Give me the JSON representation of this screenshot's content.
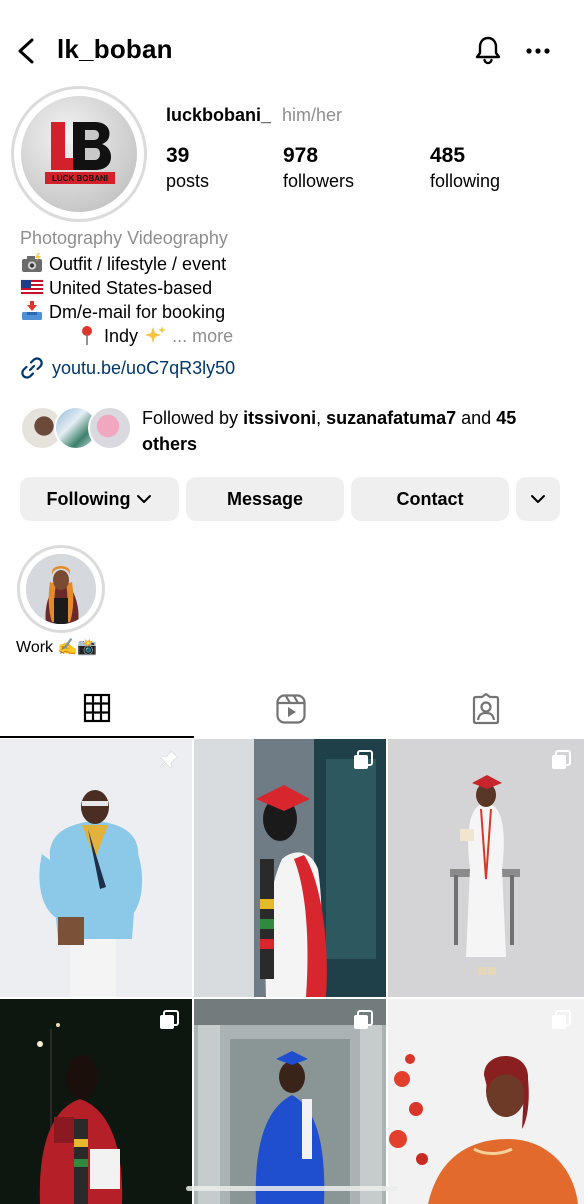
{
  "header": {
    "title": "lk_boban",
    "back_icon": "chevron-left-icon",
    "bell_icon": "bell-icon",
    "more_icon": "more-horizontal-icon"
  },
  "profile": {
    "avatar_text_top": "LB",
    "avatar_text_bottom": "LUCK BOBANI",
    "username": "luckbobani_",
    "pronouns": "him/her",
    "stats": [
      {
        "value": "39",
        "label": "posts"
      },
      {
        "value": "978",
        "label": "followers"
      },
      {
        "value": "485",
        "label": "following"
      }
    ]
  },
  "bio": {
    "category": "Photography Videography",
    "lines": [
      {
        "emoji": "camera-flash-icon",
        "text": "Outfit / lifestyle / event"
      },
      {
        "emoji": "us-flag-icon",
        "text": "United States-based"
      },
      {
        "emoji": "inbox-tray-icon",
        "text": "Dm/e-mail for booking"
      }
    ],
    "location": {
      "emoji": "pin-icon",
      "text": "Indy",
      "sparkle": "sparkles-icon",
      "more": "... more"
    },
    "link": "youtu.be/uoC7qR3ly50"
  },
  "mutual": {
    "prefix": "Followed by ",
    "user1": "itssivoni",
    "separator": ", ",
    "user2": "suzanafatuma7",
    "and": " and ",
    "others": "45 others"
  },
  "buttons": {
    "following": "Following",
    "message": "Message",
    "contact": "Contact"
  },
  "highlight": {
    "label": "Work ✍️📸"
  },
  "tabs": [
    "grid-icon",
    "reels-icon",
    "tagged-icon"
  ],
  "colors": {
    "link": "#00376b",
    "muted": "#8e8e8e",
    "button_bg": "#efefef",
    "logo_red": "#d2212a"
  }
}
